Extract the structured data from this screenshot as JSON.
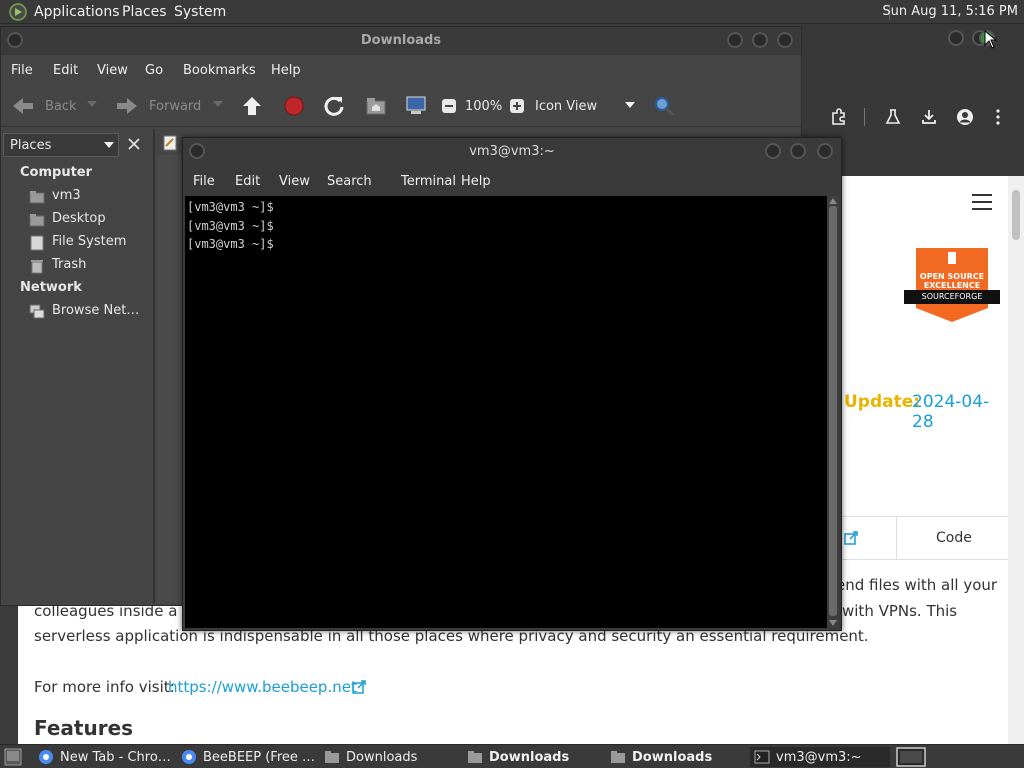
{
  "top_panel": {
    "applications": "Applications",
    "places": "Places",
    "system": "System",
    "clock": "Sun Aug 11,  5:16 PM"
  },
  "file_manager": {
    "title": "Downloads",
    "menu": [
      "File",
      "Edit",
      "View",
      "Go",
      "Bookmarks",
      "Help"
    ],
    "toolbar": {
      "back": "Back",
      "forward": "Forward",
      "zoom": "100%",
      "view_mode": "Icon View"
    },
    "sidebar": {
      "header": "Places",
      "section_computer": "Computer",
      "items_computer": [
        "vm3",
        "Desktop",
        "File System",
        "Trash"
      ],
      "section_network": "Network",
      "items_network": [
        "Browse Net…"
      ]
    }
  },
  "terminal": {
    "title": "vm3@vm3:~",
    "menu": [
      "File",
      "Edit",
      "View",
      "Search",
      "Terminal",
      "Help"
    ],
    "lines": [
      "[vm3@vm3 ~]$",
      "[vm3@vm3 ~]$",
      "[vm3@vm3 ~]$"
    ]
  },
  "browser": {
    "update_label": "Update:",
    "update_date": "2024-04-28",
    "tab_code": "Code",
    "badge_line1": "OPEN SOURCE",
    "badge_line2": "EXCELLENCE",
    "badge_brand": "SOURCEFORGE",
    "desc_frag1": "end files with all your",
    "desc_frag2": "colleagues inside a lo",
    "desc_frag3": "with VPNs. This",
    "desc_frag4": "serverless application is indispensable in all those places where privacy and security an essential requirement.",
    "more_info_label": "For more info visit:",
    "more_info_link": "https://www.beebeep.net",
    "features_heading": "Features",
    "colors": {
      "update_label": "#e8b400",
      "link": "#1a9fd6",
      "badge": "#f26a21"
    }
  },
  "taskbar": {
    "tasks": [
      "New Tab - Chro…",
      "BeeBEEP (Free …",
      "Downloads",
      "Downloads",
      "Downloads",
      "vm3@vm3:~"
    ]
  }
}
